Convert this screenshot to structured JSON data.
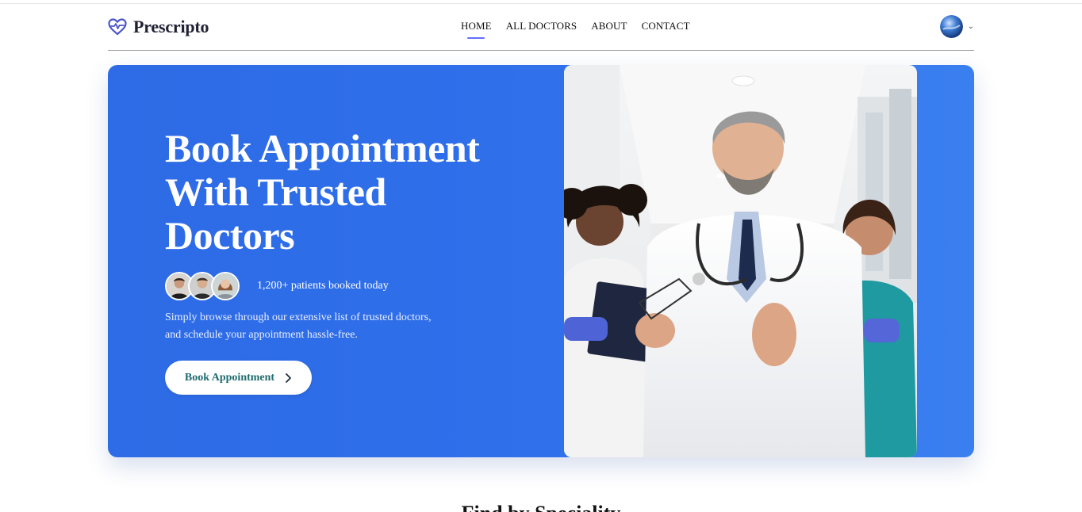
{
  "brand": {
    "name": "Prescripto",
    "accent": "#5f6fff"
  },
  "nav": {
    "items": [
      {
        "label": "HOME",
        "active": true
      },
      {
        "label": "ALL DOCTORS",
        "active": false
      },
      {
        "label": "ABOUT",
        "active": false
      },
      {
        "label": "CONTACT",
        "active": false
      }
    ]
  },
  "hero": {
    "title_line1": "Book Appointment",
    "title_line2": "With Trusted",
    "title_line3": "Doctors",
    "patients_text": "1,200+ patients booked today",
    "desc_line1": "Simply browse through our extensive list of trusted doctors,",
    "desc_line2": "and schedule your appointment hassle-free.",
    "cta_label": "Book Appointment",
    "background": "#2f6fea"
  },
  "section": {
    "title": "Find by Speciality"
  }
}
